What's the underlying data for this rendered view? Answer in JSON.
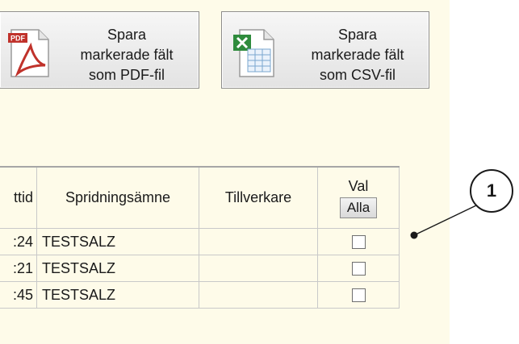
{
  "buttons": {
    "pdf": {
      "label": "Spara\nmarkerade fält\nsom PDF-fil",
      "icon": "pdf-icon"
    },
    "csv": {
      "label": "Spara\nmarkerade fält\nsom CSV-fil",
      "icon": "excel-csv-icon"
    }
  },
  "table": {
    "headers": {
      "col1": "ttid",
      "col2": "Spridningsämne",
      "col3": "Tillverkare",
      "col4": "Val",
      "select_all": "Alla"
    },
    "rows": [
      {
        "time": ":24",
        "substance": "TESTSALZ",
        "manufacturer": "",
        "checked": false
      },
      {
        "time": ":21",
        "substance": "TESTSALZ",
        "manufacturer": "",
        "checked": false
      },
      {
        "time": ":45",
        "substance": "TESTSALZ",
        "manufacturer": "",
        "checked": false
      }
    ]
  },
  "callout": {
    "number": "1"
  },
  "colors": {
    "panel_bg": "#fefbe9",
    "pdf_red": "#c0322b",
    "excel_green": "#2e8b3c"
  }
}
